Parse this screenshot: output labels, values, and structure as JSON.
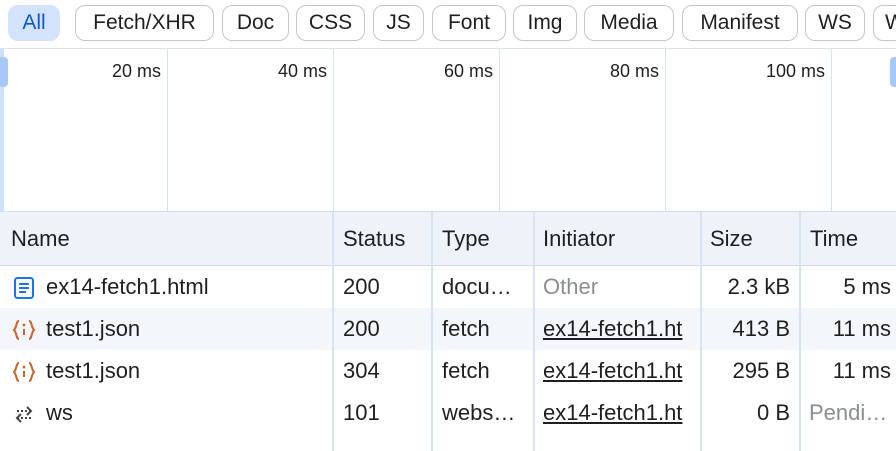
{
  "filters": [
    {
      "label": "All",
      "active": true
    },
    {
      "label": "Fetch/XHR",
      "active": false
    },
    {
      "label": "Doc",
      "active": false
    },
    {
      "label": "CSS",
      "active": false
    },
    {
      "label": "JS",
      "active": false
    },
    {
      "label": "Font",
      "active": false
    },
    {
      "label": "Img",
      "active": false
    },
    {
      "label": "Media",
      "active": false
    },
    {
      "label": "Manifest",
      "active": false
    },
    {
      "label": "WS",
      "active": false
    },
    {
      "label": "W",
      "active": false
    }
  ],
  "overview": {
    "ticks": [
      "20 ms",
      "40 ms",
      "60 ms",
      "80 ms",
      "100 ms"
    ]
  },
  "table": {
    "headers": {
      "name": "Name",
      "status": "Status",
      "type": "Type",
      "initiator": "Initiator",
      "size": "Size",
      "time": "Time"
    },
    "rows": [
      {
        "icon": "document-icon",
        "name": "ex14-fetch1.html",
        "status": "200",
        "type": "docu…",
        "initiator": "Other",
        "size": "2.3 kB",
        "time": "5 ms"
      },
      {
        "icon": "json-icon",
        "name": "test1.json",
        "status": "200",
        "type": "fetch",
        "initiator": "ex14-fetch1.ht",
        "size": "413 B",
        "time": "11 ms"
      },
      {
        "icon": "json-icon",
        "name": "test1.json",
        "status": "304",
        "type": "fetch",
        "initiator": "ex14-fetch1.ht",
        "size": "295 B",
        "time": "11 ms"
      },
      {
        "icon": "websocket-icon",
        "name": "ws",
        "status": "101",
        "type": "webs…",
        "initiator": "ex14-fetch1.ht",
        "size": "0 B",
        "time": "Pendi…"
      }
    ]
  },
  "colors": {
    "active_chip_bg": "#d3e3fd",
    "active_chip_text": "#0b57d0",
    "json_icon": "#c5652f",
    "doc_icon": "#1a73e8"
  }
}
